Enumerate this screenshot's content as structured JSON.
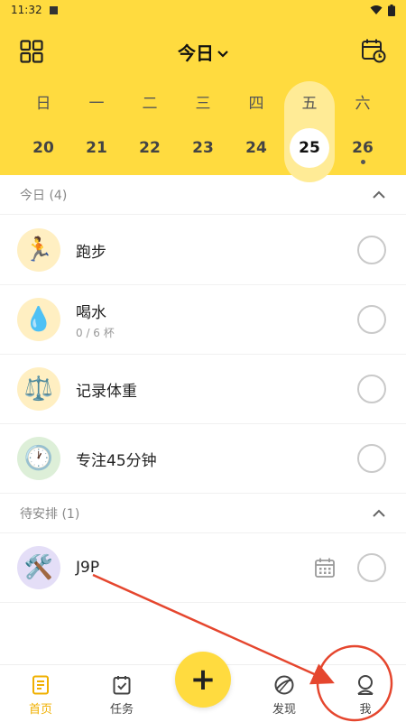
{
  "status_bar": {
    "time": "11:32"
  },
  "header": {
    "title": "今日"
  },
  "week": [
    {
      "weekday": "日",
      "date": "20",
      "selected": false,
      "has_dot": false
    },
    {
      "weekday": "一",
      "date": "21",
      "selected": false,
      "has_dot": false
    },
    {
      "weekday": "二",
      "date": "22",
      "selected": false,
      "has_dot": false
    },
    {
      "weekday": "三",
      "date": "23",
      "selected": false,
      "has_dot": false
    },
    {
      "weekday": "四",
      "date": "24",
      "selected": false,
      "has_dot": false
    },
    {
      "weekday": "五",
      "date": "25",
      "selected": true,
      "has_dot": false
    },
    {
      "weekday": "六",
      "date": "26",
      "selected": false,
      "has_dot": true
    }
  ],
  "today_section": {
    "label": "今日 (4)"
  },
  "tasks": [
    {
      "name": "跑步",
      "sub": "",
      "emoji": "🏃",
      "bg": "#FFEFC2"
    },
    {
      "name": "喝水",
      "sub": "0 / 6 杯",
      "emoji": "💧",
      "bg": "#FFEFC2"
    },
    {
      "name": "记录体重",
      "sub": "",
      "emoji": "⚖️",
      "bg": "#FFEFC2"
    },
    {
      "name": "专注45分钟",
      "sub": "",
      "emoji": "🕐",
      "bg": "#DDEFD8"
    }
  ],
  "pending_section": {
    "label": "待安排 (1)"
  },
  "pending_tasks": [
    {
      "name": "J9P",
      "emoji": "🛠️",
      "bg": "#E4DEF7"
    }
  ],
  "bottom_nav": {
    "home": "首页",
    "tasks": "任务",
    "add": "+",
    "discover": "发现",
    "me": "我"
  },
  "colors": {
    "accent": "#FFDB3F",
    "active_nav": "#F0B000",
    "annotation": "#E5462E"
  }
}
